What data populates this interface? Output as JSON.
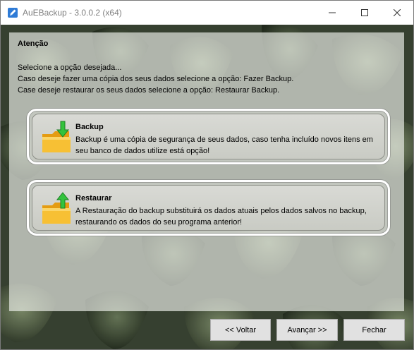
{
  "window": {
    "title": "AuEBackup - 3.0.0.2 (x64)"
  },
  "panel": {
    "heading": "Atenção",
    "instructions": [
      "Selecione a opção desejada...",
      "Caso deseje fazer uma cópia dos seus dados selecione a opção: Fazer Backup.",
      "Case deseje restaurar os seus dados selecione a opção: Restaurar Backup."
    ]
  },
  "options": {
    "backup": {
      "title": "Backup",
      "description_line1": "Backup é uma cópia de segurança de seus dados, caso tenha incluído novos itens em",
      "description_line2": "seu banco de dados utilize está opção!",
      "icon": "folder-arrow-down-icon"
    },
    "restore": {
      "title": "Restaurar",
      "description_line1": "A Restauração do backup substituirá os dados atuais pelos dados salvos no backup,",
      "description_line2": "restaurando os dados do seu programa anterior!",
      "icon": "folder-arrow-up-icon"
    }
  },
  "buttons": {
    "back": "<< Voltar",
    "next": "Avançar >>",
    "close": "Fechar"
  },
  "colors": {
    "folder": "#f5b82e",
    "arrow": "#2fbf3a"
  }
}
